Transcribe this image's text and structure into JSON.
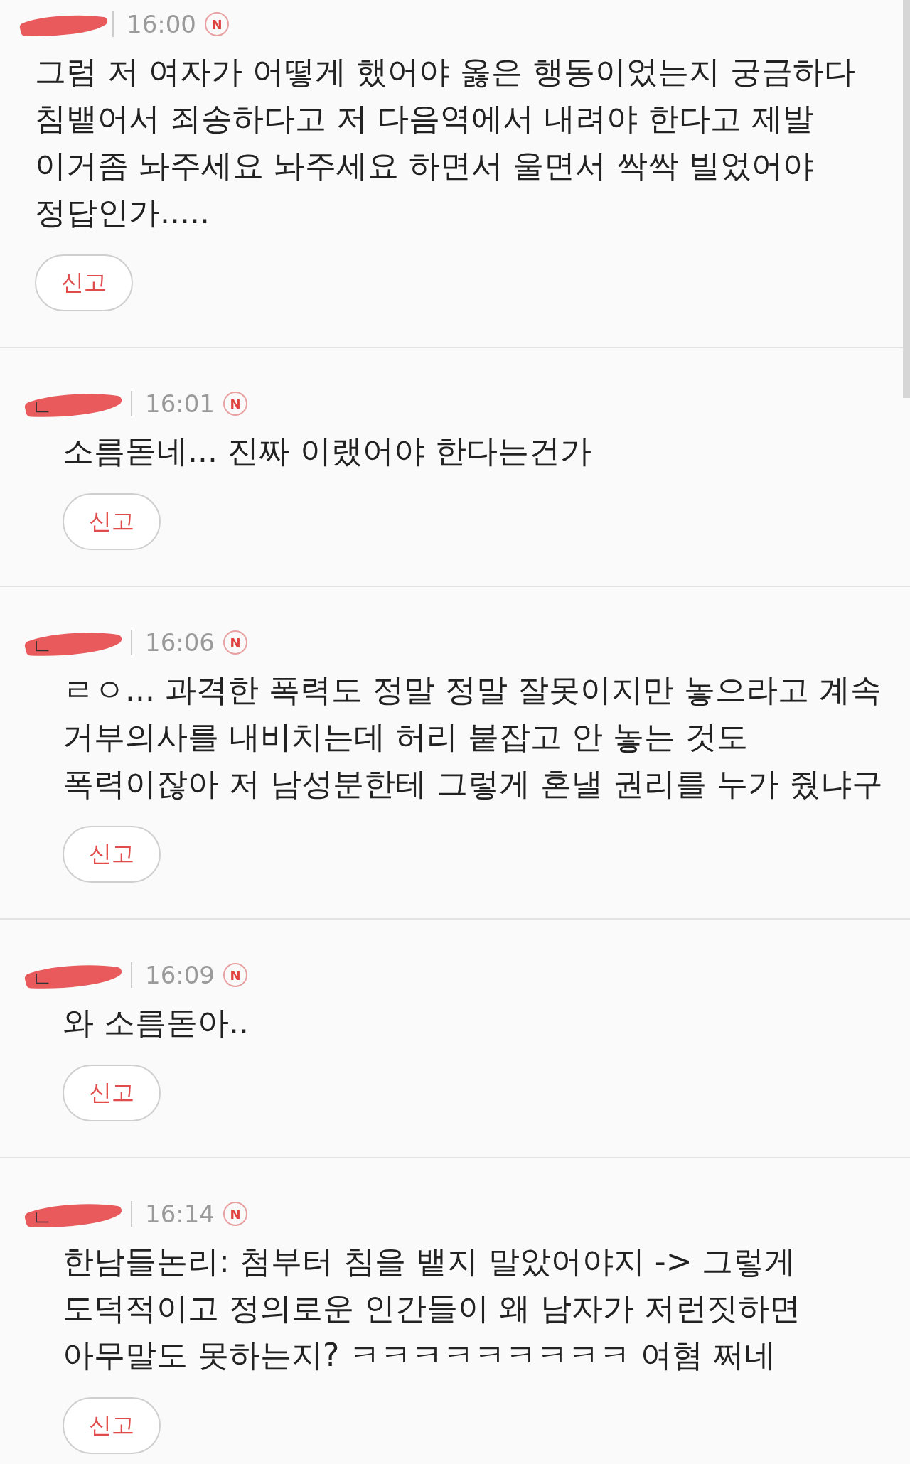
{
  "comments": [
    {
      "kind": "comment",
      "time": "16:00",
      "badge": "N",
      "text": "그럼 저 여자가 어떻게 했어야 옳은 행동이었는지 궁금하다 침뱉어서 죄송하다고 저 다음역에서 내려야 한다고 제발 이거좀 놔주세요 놔주세요 하면서 울면서 싹싹 빌었어야 정답인가.....",
      "report": "신고"
    },
    {
      "kind": "reply",
      "mark": "ㄴ",
      "time": "16:01",
      "badge": "N",
      "text": "소름돋네... 진짜 이랬어야 한다는건가",
      "report": "신고"
    },
    {
      "kind": "reply",
      "mark": "ㄴ",
      "time": "16:06",
      "badge": "N",
      "text": "ㄹㅇ... 과격한 폭력도 정말 정말 잘못이지만 놓으라고 계속 거부의사를 내비치는데 허리 붙잡고 안 놓는 것도 폭력이잖아 저 남성분한테 그렇게 혼낼 권리를 누가 줬냐구",
      "report": "신고"
    },
    {
      "kind": "reply",
      "mark": "ㄴ",
      "time": "16:09",
      "badge": "N",
      "text": "와 소름돋아..",
      "report": "신고"
    },
    {
      "kind": "reply",
      "mark": "ㄴ",
      "time": "16:14",
      "badge": "N",
      "text": "한남들논리: 첨부터 침을 뱉지 말았어야지 -> 그렇게 도덕적이고 정의로운 인간들이 왜 남자가 저런짓하면 아무말도 못하는지? ㅋㅋㅋㅋㅋㅋㅋㅋㅋ 여혐 쩌네",
      "report": "신고"
    }
  ]
}
